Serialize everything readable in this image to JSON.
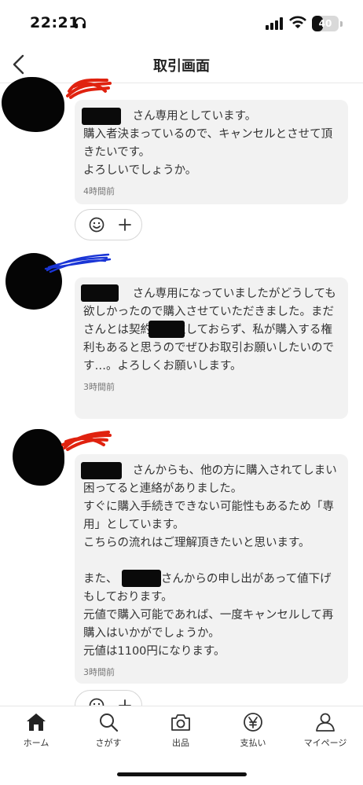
{
  "status_bar": {
    "time": "22:21",
    "battery": "40",
    "battery_level": 0.4
  },
  "nav": {
    "title": "取引画面"
  },
  "messages": [
    {
      "text": "　　　　 さん専用としています。\n購入者決まっているので、キャンセルとさせて頂きたいです。\nよろしいでしょうか。",
      "time": "4時間前"
    },
    {
      "text": "　　　　 さん専用になっていましたがどうしても欲しかったので購入させていただきました。まだ　　　　さんとは契約が成立しておらず、私が購入する権利もあると思うのでぜひお取引お願いしたいのです…。よろしくお願いします。",
      "time": "3時間前"
    },
    {
      "text": "　　　　 さんからも、他の方に購入されてしまい困ってると連絡がありました。\nすぐに購入手続きできない可能性もあるため「専用」としています。\nこちらの流れはご理解頂きたいと思います。\n\nまた、　　　　 さんからの申し出があって値下げもしております。\n元値で購入可能であれば、一度キャンセルして再購入はいかがでしょうか。\n元値は1100円になります。",
      "time": "3時間前"
    }
  ],
  "colors": {
    "scribble_red": "#e0220f",
    "scribble_blue": "#1a35d6"
  },
  "tabs": [
    {
      "label": "ホーム",
      "icon": "home-icon"
    },
    {
      "label": "さがす",
      "icon": "search-icon"
    },
    {
      "label": "出品",
      "icon": "camera-icon"
    },
    {
      "label": "支払い",
      "icon": "yen-icon"
    },
    {
      "label": "マイページ",
      "icon": "person-icon"
    }
  ]
}
